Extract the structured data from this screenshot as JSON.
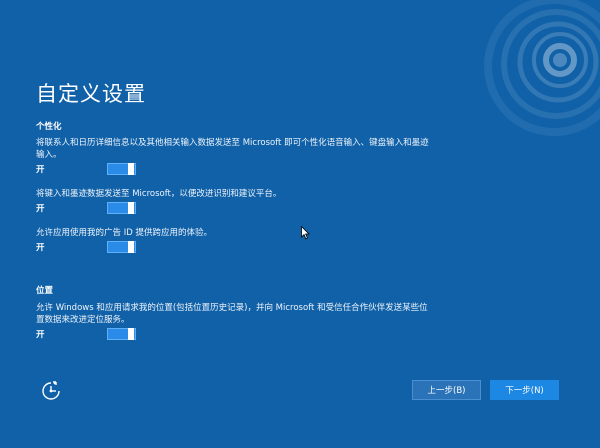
{
  "page": {
    "title": "自定义设置"
  },
  "personalization": {
    "heading": "个性化",
    "settings": [
      {
        "description": "将联系人和日历详细信息以及其他相关输入数据发送至 Microsoft 即可个性化语音输入、键盘输入和墨迹输入。",
        "state_label": "开",
        "on": true
      },
      {
        "description": "将键入和墨迹数据发送至 Microsoft，以便改进识别和建议平台。",
        "state_label": "开",
        "on": true
      },
      {
        "description": "允许应用使用我的广告 ID 提供跨应用的体验。",
        "state_label": "开",
        "on": true
      }
    ]
  },
  "location": {
    "heading": "位置",
    "settings": [
      {
        "description": "允许 Windows 和应用请求我的位置(包括位置历史记录)，并向 Microsoft 和受信任合作伙伴发送某些位置数据来改进定位服务。",
        "state_label": "开",
        "on": true
      }
    ]
  },
  "footer": {
    "accessibility_icon": "ease-of-access-icon",
    "back_label": "上一步(B)",
    "next_label": "下一步(N)"
  },
  "colors": {
    "background": "#1061a8",
    "toggle_on": "#2a8ce8",
    "next_button": "#1d87e4",
    "back_button": "#2b73b8"
  }
}
